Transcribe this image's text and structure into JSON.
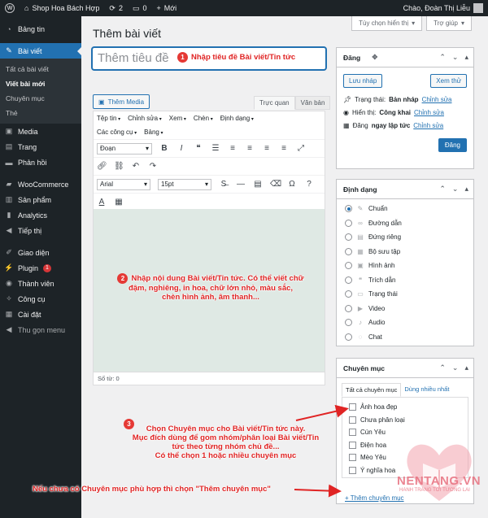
{
  "adminbar": {
    "site_name": "Shop Hoa Bách Hợp",
    "updates": "2",
    "comments": "0",
    "new_label": "Mới",
    "greeting": "Chào, Đoàn Thị Liễu"
  },
  "sidebar": {
    "items": [
      {
        "label": "Bảng tin",
        "icon": "gauge-icon"
      },
      {
        "label": "Bài viết",
        "icon": "pin-icon"
      },
      {
        "label": "Media",
        "icon": "media-icon"
      },
      {
        "label": "Trang",
        "icon": "page-icon"
      },
      {
        "label": "Phản hồi",
        "icon": "comment-icon"
      },
      {
        "label": "WooCommerce",
        "icon": "woo-icon"
      },
      {
        "label": "Sản phẩm",
        "icon": "product-icon"
      },
      {
        "label": "Analytics",
        "icon": "chart-icon"
      },
      {
        "label": "Tiếp thị",
        "icon": "megaphone-icon"
      },
      {
        "label": "Giao diện",
        "icon": "brush-icon"
      },
      {
        "label": "Plugin",
        "icon": "plugin-icon",
        "badge": "1"
      },
      {
        "label": "Thành viên",
        "icon": "user-icon"
      },
      {
        "label": "Công cụ",
        "icon": "wrench-icon"
      },
      {
        "label": "Cài đặt",
        "icon": "settings-icon"
      },
      {
        "label": "Thu gọn menu",
        "icon": "collapse-icon"
      }
    ],
    "submenu": [
      "Tất cả bài viết",
      "Viết bài mới",
      "Chuyên mục",
      "Thẻ"
    ]
  },
  "screen": {
    "options": "Tùy chọn hiển thị",
    "help": "Trợ giúp"
  },
  "main": {
    "title": "Thêm bài viết",
    "title_placeholder": "Thêm tiêu đề",
    "add_media": "Thêm Media",
    "tab_visual": "Trực quan",
    "tab_text": "Văn bản",
    "menus": [
      "Tệp tin",
      "Chỉnh sửa",
      "Xem",
      "Chèn",
      "Định dạng",
      "Các công cụ",
      "Bảng"
    ],
    "paragraph": "Đoạn",
    "font": "Arial",
    "size": "15pt",
    "word_count": "Số từ: 0"
  },
  "publish": {
    "title": "Đăng",
    "save_draft": "Lưu nháp",
    "preview": "Xem thử",
    "status_label": "Trạng thái:",
    "status_value": "Bản nháp",
    "visibility_label": "Hiển thị:",
    "visibility_value": "Công khai",
    "schedule_label": "Đăng",
    "schedule_value": "ngay lập tức",
    "edit": "Chỉnh sửa",
    "publish_btn": "Đăng"
  },
  "format": {
    "title": "Định dạng",
    "options": [
      "Chuẩn",
      "Đường dẫn",
      "Đứng riêng",
      "Bộ sưu tập",
      "Hình ảnh",
      "Trích dẫn",
      "Trạng thái",
      "Video",
      "Audio",
      "Chat"
    ],
    "selected": "Chuẩn"
  },
  "category": {
    "title": "Chuyên mục",
    "tab_all": "Tất cả chuyên mục",
    "tab_popular": "Dùng nhiều nhất",
    "items": [
      "Ảnh hoa đẹp",
      "Chưa phân loại",
      "Cún Yêu",
      "Điện hoa",
      "Mèo Yêu",
      "Ý nghĩa hoa"
    ],
    "add_new": "+ Thêm chuyên mục"
  },
  "annotations": {
    "a1_num": "1",
    "a1": "Nhập tiêu đề Bài viết/Tin tức",
    "a2_num": "2",
    "a2_line1": "Nhập nội dung Bài viết/Tin tức. Có thể viết chữ",
    "a2_line2": "đậm, nghiêng, in hoa, chữ lớn nhỏ, màu sắc,",
    "a2_line3": "chèn hình ảnh, âm thanh...",
    "a3_num": "3",
    "a3_line1": "Chọn Chuyên mục cho Bài viết/Tin tức này.",
    "a3_line2": "Mục đích dùng để gom nhóm/phân loại Bài viết/Tin",
    "a3_line3": "tức theo từng nhóm chủ đề...",
    "a3_line4": "Có thể chọn 1 hoặc nhiều chuyên mục",
    "a4": "Nếu chưa có Chuyên mục phù hợp thì chọn \"Thêm chuyên mục\""
  },
  "watermark": {
    "brand": "NENTANG.VN",
    "tagline": "HÀNH TRANG TỚI TƯƠNG LAI"
  },
  "colors": {
    "accent": "#2271b1",
    "sidebar": "#1d2327",
    "annotation": "#e02424"
  }
}
